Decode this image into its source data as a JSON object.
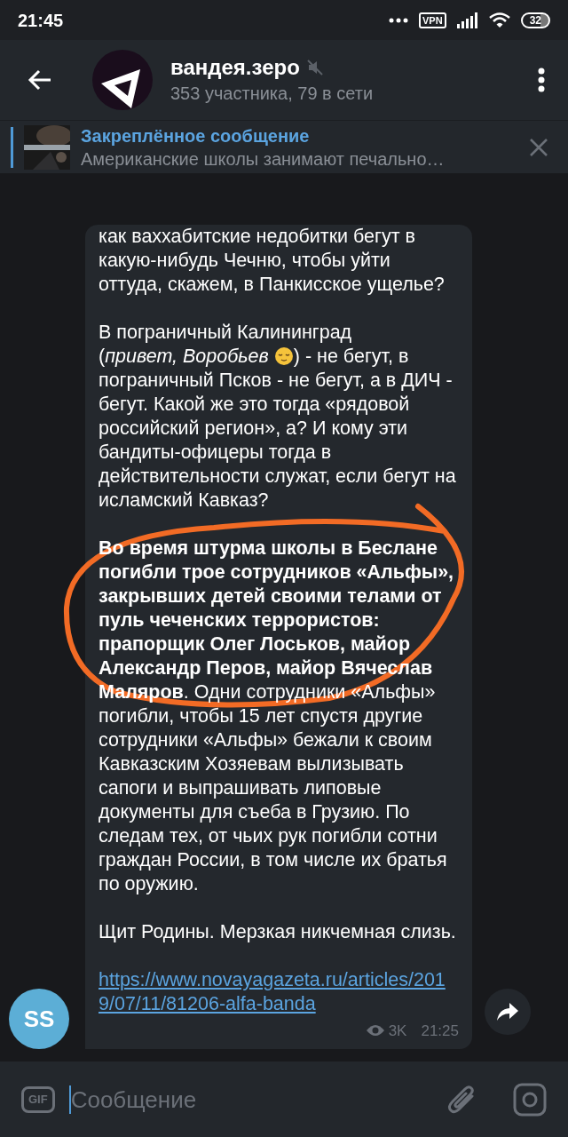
{
  "status_bar": {
    "time": "21:45",
    "vpn": "VPN",
    "battery": "32"
  },
  "header": {
    "title": "вандея.зеро",
    "muted": true,
    "subtitle": "353 участника, 79 в сети"
  },
  "pinned": {
    "title": "Закреплённое сообщение",
    "text": "Американские школы занимают печально…"
  },
  "message": {
    "author_initials": "SS",
    "paragraphs": [
      {
        "kind": "text",
        "text": "как ваххабитские недобитки бегут в какую-нибудь Чечню, чтобы уйти оттуда, скажем, в Панкисское ущелье?"
      },
      {
        "kind": "emoji",
        "first_line": "В пограничный Калининград",
        "before": "(*привет, Воробьев*",
        "after": ") - не бегут, в",
        "rest": "пограничный Псков - не бегут, а в ДИЧ - бегут. Какой же это тогда «рядовой российский регион», а? И кому эти бандиты-офицеры тогда в действительности служат, если бегут на исламский Кавказ?"
      },
      {
        "kind": "text",
        "circled": true,
        "text": "**Во время штурма школы в Беслане погибли трое сотрудников «Альфы», закрывших детей своими телами от пуль чеченских террористов: прапорщик Олег Лоськов, майор Александр Перов, майор Вячеслав Маляров**. Одни сотрудники «Альфы» погибли, чтобы 15 лет спустя другие сотрудники «Альфы» бежали к своим Кавказским Хозяевам вылизывать сапоги и выпрашивать липовые документы для съеба в Грузию. По следам тех, от чьих рук погибли сотни граждан России, в том числе их братья по оружию."
      },
      {
        "kind": "text",
        "text": "Щит Родины. Мерзкая никчемная слизь."
      },
      {
        "kind": "link",
        "text": "https://www.novayagazeta.ru/articles/2019/07/11/81206-alfa-banda"
      }
    ],
    "views": "3K",
    "time": "21:25"
  },
  "composer": {
    "gif": "GIF",
    "placeholder": "Сообщение"
  }
}
